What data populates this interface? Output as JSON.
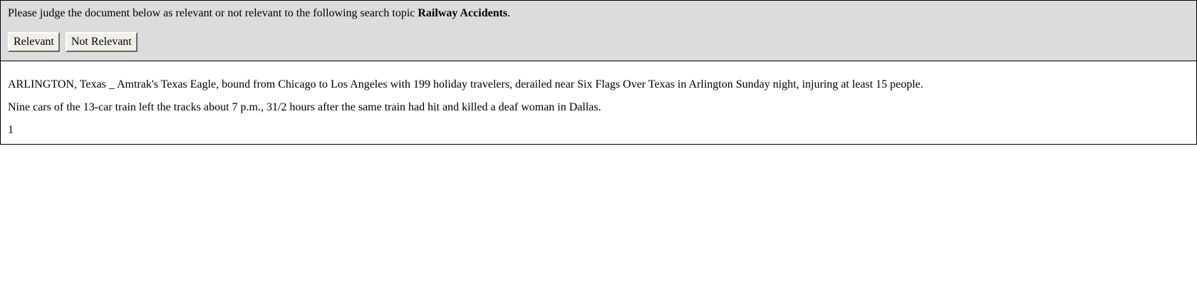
{
  "instruction": {
    "prefix": "Please judge the document below as relevant or not relevant to the following search topic ",
    "topic": "Railway Accidents",
    "suffix": "."
  },
  "buttons": {
    "relevant_label": "Relevant",
    "not_relevant_label": "Not Relevant"
  },
  "document": {
    "paragraphs": [
      "ARLINGTON, Texas _ Amtrak's Texas Eagle, bound from Chicago to Los Angeles with 199 holiday travelers, derailed near Six Flags Over Texas in Arlington Sunday night, injuring at least 15 people.",
      "Nine cars of the 13-car train left the tracks about 7 p.m., 31/2 hours after the same train had hit and killed a deaf woman in Dallas.",
      "1"
    ]
  },
  "colors": {
    "panel_background": "#dcdcdc",
    "button_background": "#f1efe8",
    "cursor_dot": "#ff0000"
  }
}
